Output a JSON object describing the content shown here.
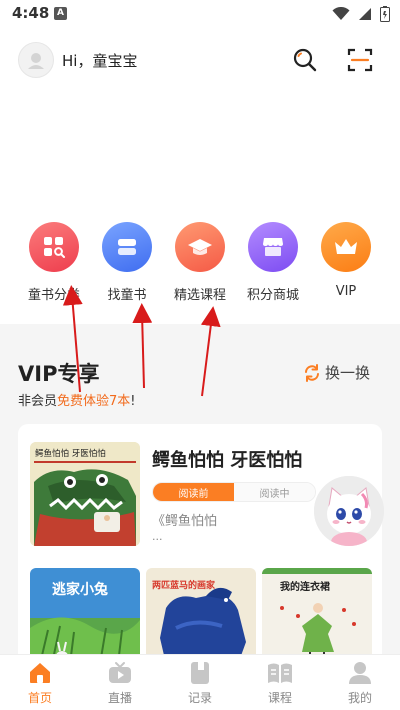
{
  "status_bar": {
    "time": "4:48",
    "notification_badge": "A"
  },
  "header": {
    "greeting": "Hi，童宝宝"
  },
  "quick_nav": [
    {
      "label": "童书分类",
      "icon": "category-icon",
      "color": "#f4525c"
    },
    {
      "label": "找童书",
      "icon": "book-stack-icon",
      "color": "#4d7cf5"
    },
    {
      "label": "精选课程",
      "icon": "graduation-cap-icon",
      "color": "#f9634c"
    },
    {
      "label": "积分商城",
      "icon": "store-icon",
      "color": "#8d5cf6"
    },
    {
      "label": "VIP",
      "icon": "crown-icon",
      "color": "#fb8a1e"
    }
  ],
  "vip": {
    "title": "VIP专享",
    "subtitle_prefix": "非会员",
    "subtitle_highlight": "免费体验7本",
    "subtitle_suffix": "!",
    "refresh_label": "换一换",
    "featured": {
      "title": "鳄鱼怕怕 牙医怕怕",
      "cover_title": "鳄鱼怕怕 牙医怕怕",
      "tab_before": "阅读前",
      "tab_during": "阅读中",
      "description": "《鳄鱼怕怕",
      "ellipsis": "..."
    },
    "books": [
      {
        "cover_title": "逃家小兔"
      },
      {
        "cover_title": "两匹蓝马的画家"
      },
      {
        "cover_title": "我的连衣裙"
      }
    ]
  },
  "bottom_nav": [
    {
      "label": "首页",
      "icon": "home-icon",
      "active": true
    },
    {
      "label": "直播",
      "icon": "tv-icon",
      "active": false
    },
    {
      "label": "记录",
      "icon": "record-icon",
      "active": false
    },
    {
      "label": "课程",
      "icon": "open-book-icon",
      "active": false
    },
    {
      "label": "我的",
      "icon": "profile-icon",
      "active": false
    }
  ],
  "colors": {
    "accent": "#fb7e23",
    "arrow": "#d81b1b",
    "section_bg": "#f5f5f5"
  }
}
